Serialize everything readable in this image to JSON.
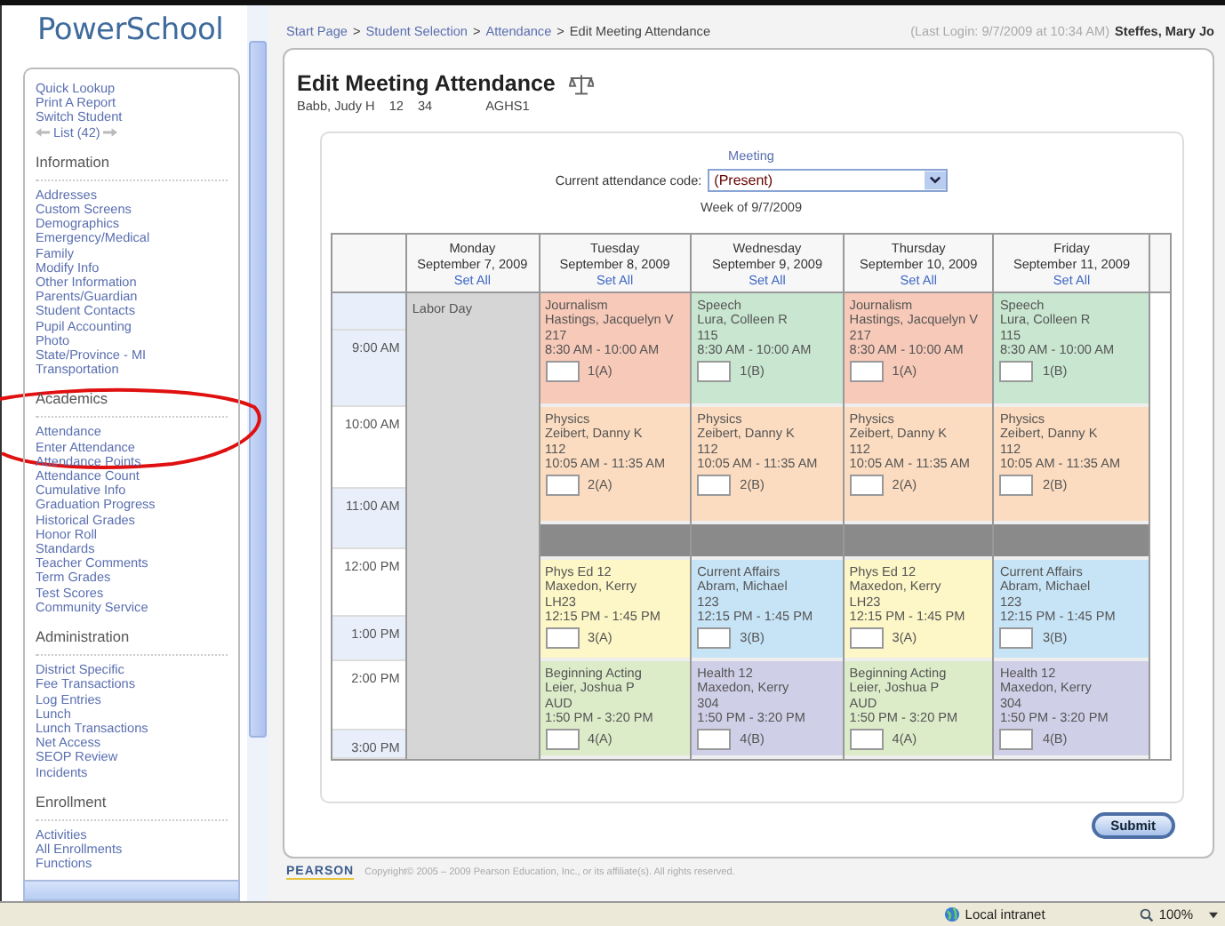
{
  "logo": "PowerSchool",
  "sidebar": {
    "quick_links": [
      "Quick Lookup",
      "Print A Report",
      "Switch Student"
    ],
    "list_link": "List (42)",
    "sections": [
      {
        "title": "Information",
        "items": [
          "Addresses",
          "Custom Screens",
          "Demographics",
          "Emergency/Medical",
          "Family",
          "Modify Info",
          "Other Information",
          "Parents/Guardian",
          "Student Contacts",
          "Pupil Accounting",
          "Photo",
          "State/Province - MI",
          "Transportation"
        ]
      },
      {
        "title": "Academics",
        "items": [
          "Attendance",
          "Enter Attendance",
          "Attendance Points",
          "Attendance Count",
          "Cumulative Info",
          "Graduation Progress",
          "Historical Grades",
          "Honor Roll",
          "Standards",
          "Teacher Comments",
          "Term Grades",
          "Test Scores",
          "Community Service"
        ]
      },
      {
        "title": "Administration",
        "items": [
          "District Specific",
          "Fee Transactions",
          "Log Entries",
          "Lunch",
          "Lunch Transactions",
          "Net Access",
          "SEOP Review",
          "Incidents"
        ]
      },
      {
        "title": "Enrollment",
        "items": [
          "Activities",
          "All Enrollments",
          "Functions"
        ]
      }
    ]
  },
  "breadcrumb": {
    "links": [
      "Start Page",
      "Student Selection",
      "Attendance"
    ],
    "separator": ">",
    "current": "Edit Meeting Attendance"
  },
  "login": {
    "last_login": "(Last Login: 9/7/2009 at 10:34 AM)",
    "user": "Steffes, Mary Jo"
  },
  "page": {
    "title": "Edit Meeting Attendance",
    "student": {
      "name": "Babb, Judy H",
      "grade": "12",
      "number": "34",
      "school": "AGHS1"
    }
  },
  "meeting_link": "Meeting",
  "code_label": "Current attendance code:",
  "code_value": "(Present)",
  "week": "Week of 9/7/2009",
  "schedule": {
    "times": [
      "9:00 AM",
      "10:00 AM",
      "11:00 AM",
      "12:00 PM",
      "1:00 PM",
      "2:00 PM",
      "3:00 PM"
    ],
    "days": [
      {
        "name": "Monday",
        "date": "September 7, 2009",
        "set_all": "Set All",
        "kind": "holiday",
        "note": "Labor Day"
      },
      {
        "name": "Tuesday",
        "date": "September 8, 2009",
        "set_all": "Set All",
        "kind": "school",
        "periods": [
          {
            "kind": "class",
            "course": "Journalism",
            "teacher": "Hastings, Jacquelyn V",
            "room": "217",
            "time": "8:30 AM - 10:00 AM",
            "code": "1(A)",
            "color": "#f7c9b8"
          },
          {
            "kind": "class",
            "course": "Physics",
            "teacher": "Zeibert, Danny K",
            "room": "112",
            "time": "10:05 AM - 11:35 AM",
            "code": "2(A)",
            "color": "#fcdcc0"
          },
          {
            "kind": "lunch"
          },
          {
            "kind": "class",
            "course": "Phys Ed 12",
            "teacher": "Maxedon, Kerry",
            "room": "LH23",
            "time": "12:15 PM - 1:45 PM",
            "code": "3(A)",
            "color": "#fdf6c6"
          },
          {
            "kind": "class",
            "course": "Beginning Acting",
            "teacher": "Leier, Joshua P",
            "room": "AUD",
            "time": "1:50 PM - 3:20 PM",
            "code": "4(A)",
            "color": "#dcecc9"
          }
        ]
      },
      {
        "name": "Wednesday",
        "date": "September 9, 2009",
        "set_all": "Set All",
        "kind": "school",
        "periods": [
          {
            "kind": "class",
            "course": "Speech",
            "teacher": "Lura, Colleen R",
            "room": "115",
            "time": "8:30 AM - 10:00 AM",
            "code": "1(B)",
            "color": "#c8e6d0"
          },
          {
            "kind": "class",
            "course": "Physics",
            "teacher": "Zeibert, Danny K",
            "room": "112",
            "time": "10:05 AM - 11:35 AM",
            "code": "2(B)",
            "color": "#fcdcc0"
          },
          {
            "kind": "lunch"
          },
          {
            "kind": "class",
            "course": "Current Affairs",
            "teacher": "Abram, Michael",
            "room": "123",
            "time": "12:15 PM - 1:45 PM",
            "code": "3(B)",
            "color": "#c7e4f6"
          },
          {
            "kind": "class",
            "course": "Health 12",
            "teacher": "Maxedon, Kerry",
            "room": "304",
            "time": "1:50 PM - 3:20 PM",
            "code": "4(B)",
            "color": "#d0cfe8"
          }
        ]
      },
      {
        "name": "Thursday",
        "date": "September 10, 2009",
        "set_all": "Set All",
        "kind": "school",
        "periods": [
          {
            "kind": "class",
            "course": "Journalism",
            "teacher": "Hastings, Jacquelyn V",
            "room": "217",
            "time": "8:30 AM - 10:00 AM",
            "code": "1(A)",
            "color": "#f7c9b8"
          },
          {
            "kind": "class",
            "course": "Physics",
            "teacher": "Zeibert, Danny K",
            "room": "112",
            "time": "10:05 AM - 11:35 AM",
            "code": "2(A)",
            "color": "#fcdcc0"
          },
          {
            "kind": "lunch"
          },
          {
            "kind": "class",
            "course": "Phys Ed 12",
            "teacher": "Maxedon, Kerry",
            "room": "LH23",
            "time": "12:15 PM - 1:45 PM",
            "code": "3(A)",
            "color": "#fdf6c6"
          },
          {
            "kind": "class",
            "course": "Beginning Acting",
            "teacher": "Leier, Joshua P",
            "room": "AUD",
            "time": "1:50 PM - 3:20 PM",
            "code": "4(A)",
            "color": "#dcecc9"
          }
        ]
      },
      {
        "name": "Friday",
        "date": "September 11, 2009",
        "set_all": "Set All",
        "kind": "school",
        "periods": [
          {
            "kind": "class",
            "course": "Speech",
            "teacher": "Lura, Colleen R",
            "room": "115",
            "time": "8:30 AM - 10:00 AM",
            "code": "1(B)",
            "color": "#c8e6d0"
          },
          {
            "kind": "class",
            "course": "Physics",
            "teacher": "Zeibert, Danny K",
            "room": "112",
            "time": "10:05 AM - 11:35 AM",
            "code": "2(B)",
            "color": "#fcdcc0"
          },
          {
            "kind": "lunch"
          },
          {
            "kind": "class",
            "course": "Current Affairs",
            "teacher": "Abram, Michael",
            "room": "123",
            "time": "12:15 PM - 1:45 PM",
            "code": "3(B)",
            "color": "#c7e4f6"
          },
          {
            "kind": "class",
            "course": "Health 12",
            "teacher": "Maxedon, Kerry",
            "room": "304",
            "time": "1:50 PM - 3:20 PM",
            "code": "4(B)",
            "color": "#d0cfe8"
          }
        ]
      }
    ]
  },
  "submit": "Submit",
  "footer": {
    "brand": "PEARSON",
    "copyright": "Copyright© 2005 – 2009 Pearson Education, Inc., or its affiliate(s). All rights reserved."
  },
  "status_bar": {
    "zone": "Local intranet",
    "zoom": "100%"
  }
}
